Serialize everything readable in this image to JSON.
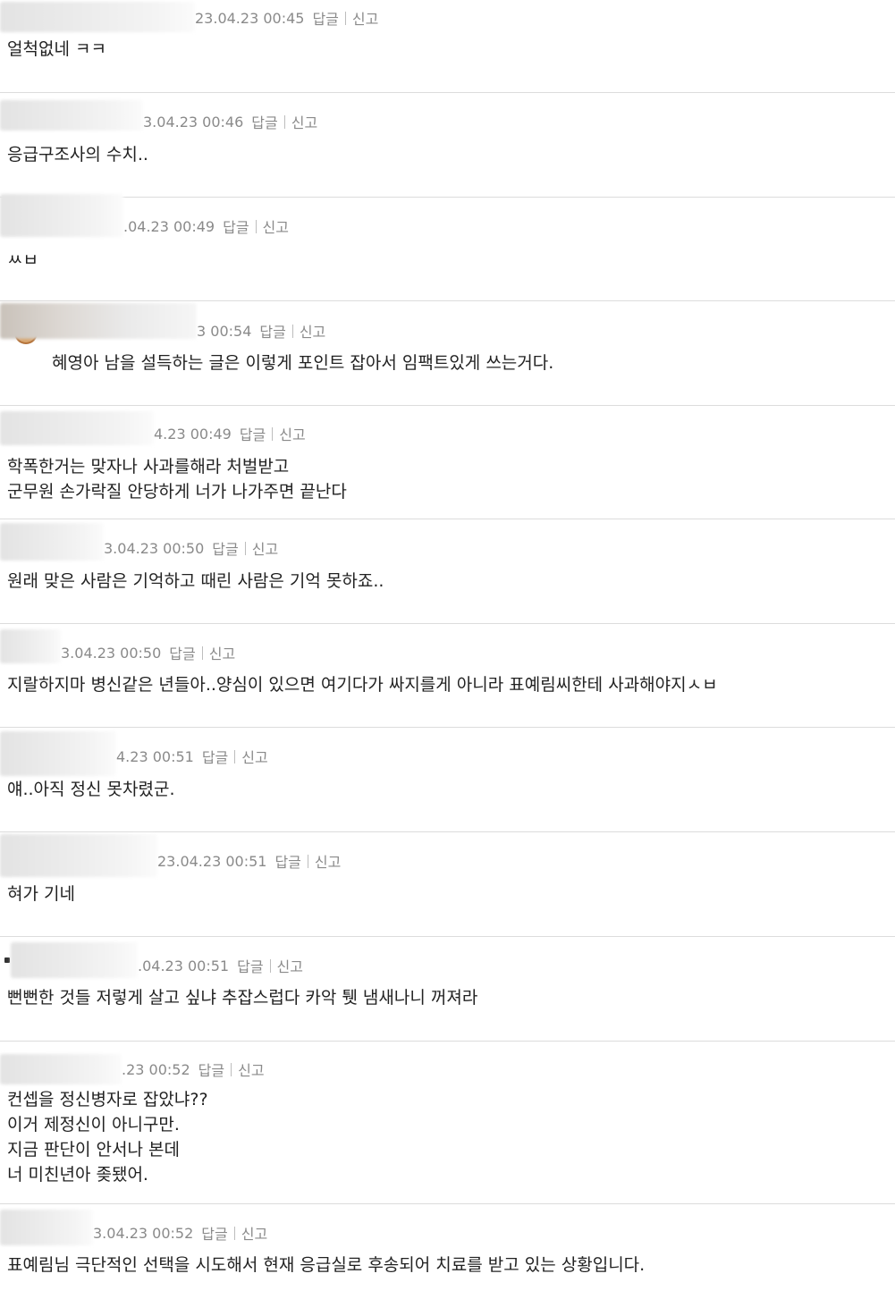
{
  "actions": {
    "reply": "답글",
    "report": "신고"
  },
  "comments": [
    {
      "date": "23.04.23 00:45",
      "text": "얼척없네 ㅋㅋ"
    },
    {
      "date": "3.04.23 00:46",
      "text": "응급구조사의 수치.."
    },
    {
      "date": ".04.23 00:49",
      "text": "ㅆㅂ"
    },
    {
      "date": "3 00:54",
      "text": "혜영아 남을 설득하는 글은 이렇게 포인트 잡아서 임팩트있게 쓰는거다."
    },
    {
      "date": "4.23 00:49",
      "text": "학폭한거는 맞자나 사과를해라 처벌받고\n군무원 손가락질 안당하게 너가 나가주면 끝난다"
    },
    {
      "date": "3.04.23 00:50",
      "text": "원래 맞은 사람은 기억하고 때린 사람은 기억 못하죠.."
    },
    {
      "date": "3.04.23 00:50",
      "text": "지랄하지마 병신같은 년들아..양심이 있으면 여기다가 싸지를게 아니라 표예림씨한테 사과해야지ㅅㅂ"
    },
    {
      "date": "4.23 00:51",
      "text": "얘..아직 정신 못차렸군."
    },
    {
      "date": "23.04.23 00:51",
      "text": "혀가 기네"
    },
    {
      "date": ".04.23 00:51",
      "text": "뻔뻔한 것들 저렇게 살고 싶냐 추잡스럽다 카악 퉷 냄새나니 꺼져라"
    },
    {
      "date": ".23 00:52",
      "text": "컨셉을 정신병자로 잡았냐??\n이거 제정신이 아니구만.\n지금 판단이 안서나 본데\n너 미친년아 좆됐어."
    },
    {
      "date": "3.04.23 00:52",
      "text": "표예림님 극단적인 선택을 시도해서 현재 응급실로 후송되어 치료를 받고 있는 상황입니다."
    }
  ]
}
